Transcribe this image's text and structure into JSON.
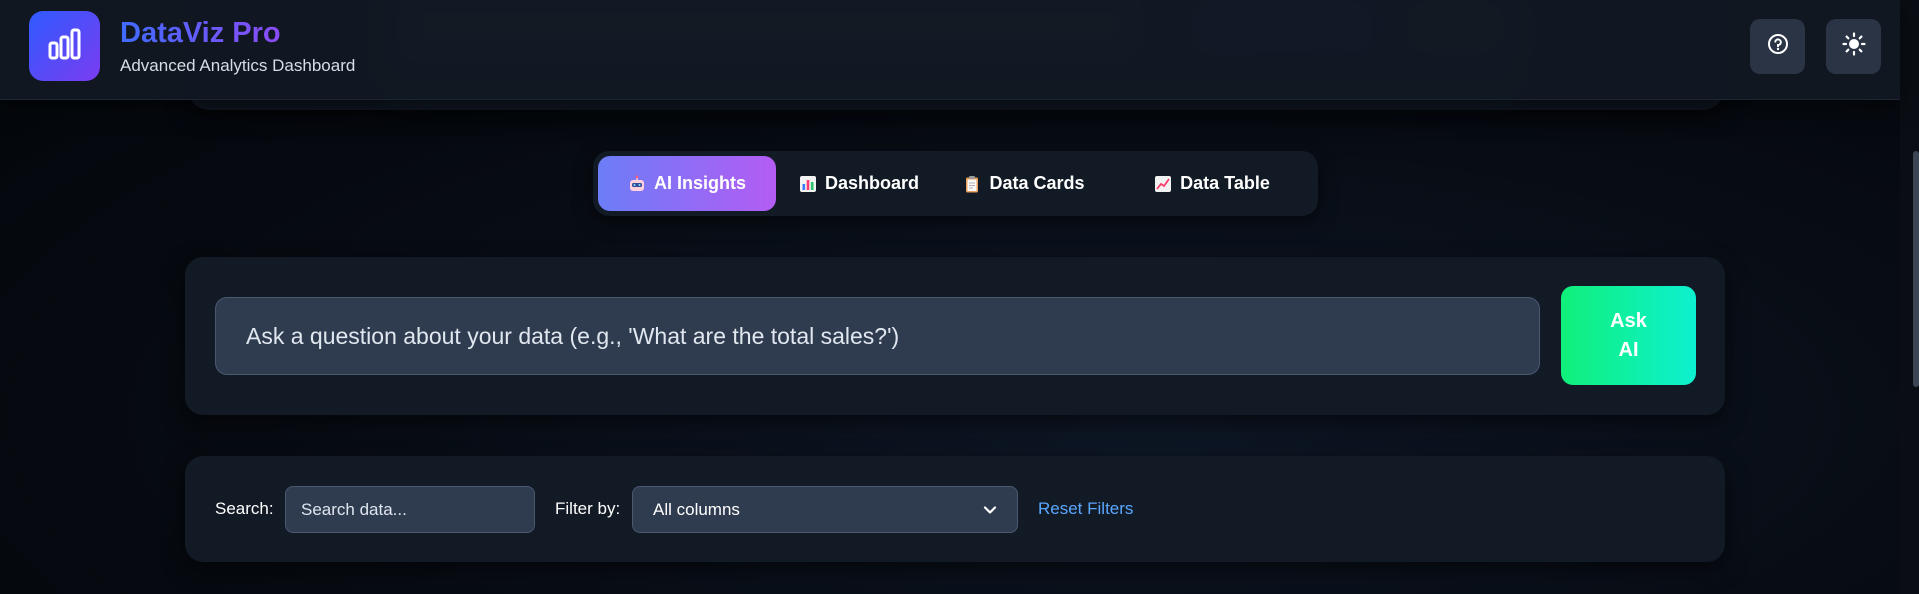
{
  "header": {
    "title": "DataViz Pro",
    "subtitle": "Advanced Analytics Dashboard",
    "logo_icon": "bar-chart-icon",
    "help_icon": "help-circle-icon",
    "theme_icon": "sun-icon"
  },
  "tabs": [
    {
      "label": "AI Insights",
      "icon": "robot-icon",
      "active": true
    },
    {
      "label": "Dashboard",
      "icon": "bar-chart-emoji-icon",
      "active": false
    },
    {
      "label": "Data Cards",
      "icon": "clipboard-icon",
      "active": false
    },
    {
      "label": "Data Table",
      "icon": "trend-chart-icon",
      "active": false
    }
  ],
  "ask": {
    "placeholder": "Ask a question about your data (e.g., 'What are the total sales?')",
    "button_line1": "Ask",
    "button_line2": "AI"
  },
  "filters": {
    "search_label": "Search:",
    "search_placeholder": "Search data...",
    "filter_label": "Filter by:",
    "filter_selected": "All columns",
    "reset_label": "Reset Filters"
  },
  "colors": {
    "brand_gradient_start": "#3f6bff",
    "brand_gradient_end": "#8b4cf5",
    "active_tab_start": "#6b7df7",
    "active_tab_end": "#b45cf4",
    "ask_button_start": "#10f07a",
    "ask_button_end": "#0df0d0",
    "link": "#5aa7ff",
    "panel": "#121a25"
  }
}
